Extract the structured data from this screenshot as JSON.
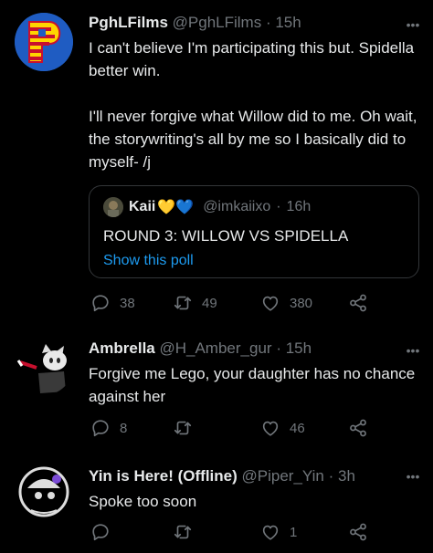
{
  "tweets": [
    {
      "name": "PghLFilms",
      "handle": "@PghLFilms",
      "time": "15h",
      "text": "I can't believe I'm participating this but. Spidella better win.\n\nI'll never forgive what Willow did to me. Oh wait, the storywriting's all by me so I basically did to myself- /j",
      "quote": {
        "name": "Kaii",
        "emoji": "💛💙",
        "handle": "@imkaiixo",
        "time": "16h",
        "text": "ROUND 3: WILLOW VS SPIDELLA",
        "link": "Show this poll"
      },
      "replies": "38",
      "retweets": "49",
      "likes": "380"
    },
    {
      "name": "Ambrella",
      "handle": "@H_Amber_gur",
      "time": "15h",
      "text": "Forgive me Lego, your daughter has no chance against her",
      "replies": "8",
      "retweets": "",
      "likes": "46"
    },
    {
      "name": "Yin is Here! (Offline)",
      "handle": "@Piper_Yin",
      "time": "3h",
      "text": "Spoke too soon",
      "replies": "",
      "retweets": "",
      "likes": "1"
    }
  ],
  "separator": "·",
  "more_glyph": "•••",
  "icons": {
    "reply": "reply-icon",
    "retweet": "retweet-icon",
    "like": "heart-icon",
    "share": "share-icon"
  },
  "colors": {
    "background": "#000000",
    "text": "#e7e9ea",
    "muted": "#71767b",
    "link": "#1d9bf0",
    "border": "#333639"
  }
}
